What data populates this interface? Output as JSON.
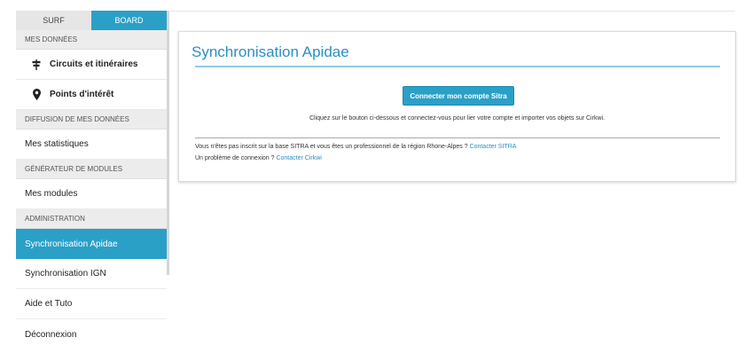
{
  "tabs": [
    {
      "label": "SURF"
    },
    {
      "label": "BOARD"
    }
  ],
  "sidebar": {
    "sections": [
      {
        "header": "MES DONNÉES"
      },
      {
        "header": "DIFFUSION DE MES DONNÉES"
      },
      {
        "header": "GÉNÉRATEUR DE MODULES"
      },
      {
        "header": "ADMINISTRATION"
      }
    ],
    "items": {
      "circuits": "Circuits et itinéraires",
      "points": "Points d'intérêt",
      "stats": "Mes statistiques",
      "modules": "Mes modules",
      "apidae": "Synchronisation Apidae",
      "ign": "Synchronisation IGN",
      "aide": "Aide et Tuto",
      "logout": "Déconnexion"
    },
    "icons": {
      "circuits": "signpost-icon",
      "points": "map-pin-icon"
    }
  },
  "panel": {
    "title": "Synchronisation Apidae",
    "button": "Connecter mon compte Sitra",
    "instruction": "Cliquez sur le bouton ci-dessous et connectez-vous pour lier votre compte et importer vos objets sur Cirkwi.",
    "help1_text": "Vous n'êtes pas inscrit sur la base SITRA et vous êtes un professionnel de la région Rhone-Alpes ? ",
    "help1_link": "Contacter SITRA",
    "help2_text": "Un problème de connexion ? ",
    "help2_link": "Contacter Cirkwi"
  },
  "colors": {
    "accent": "#2aa0c7",
    "title": "#2a8fc0"
  }
}
